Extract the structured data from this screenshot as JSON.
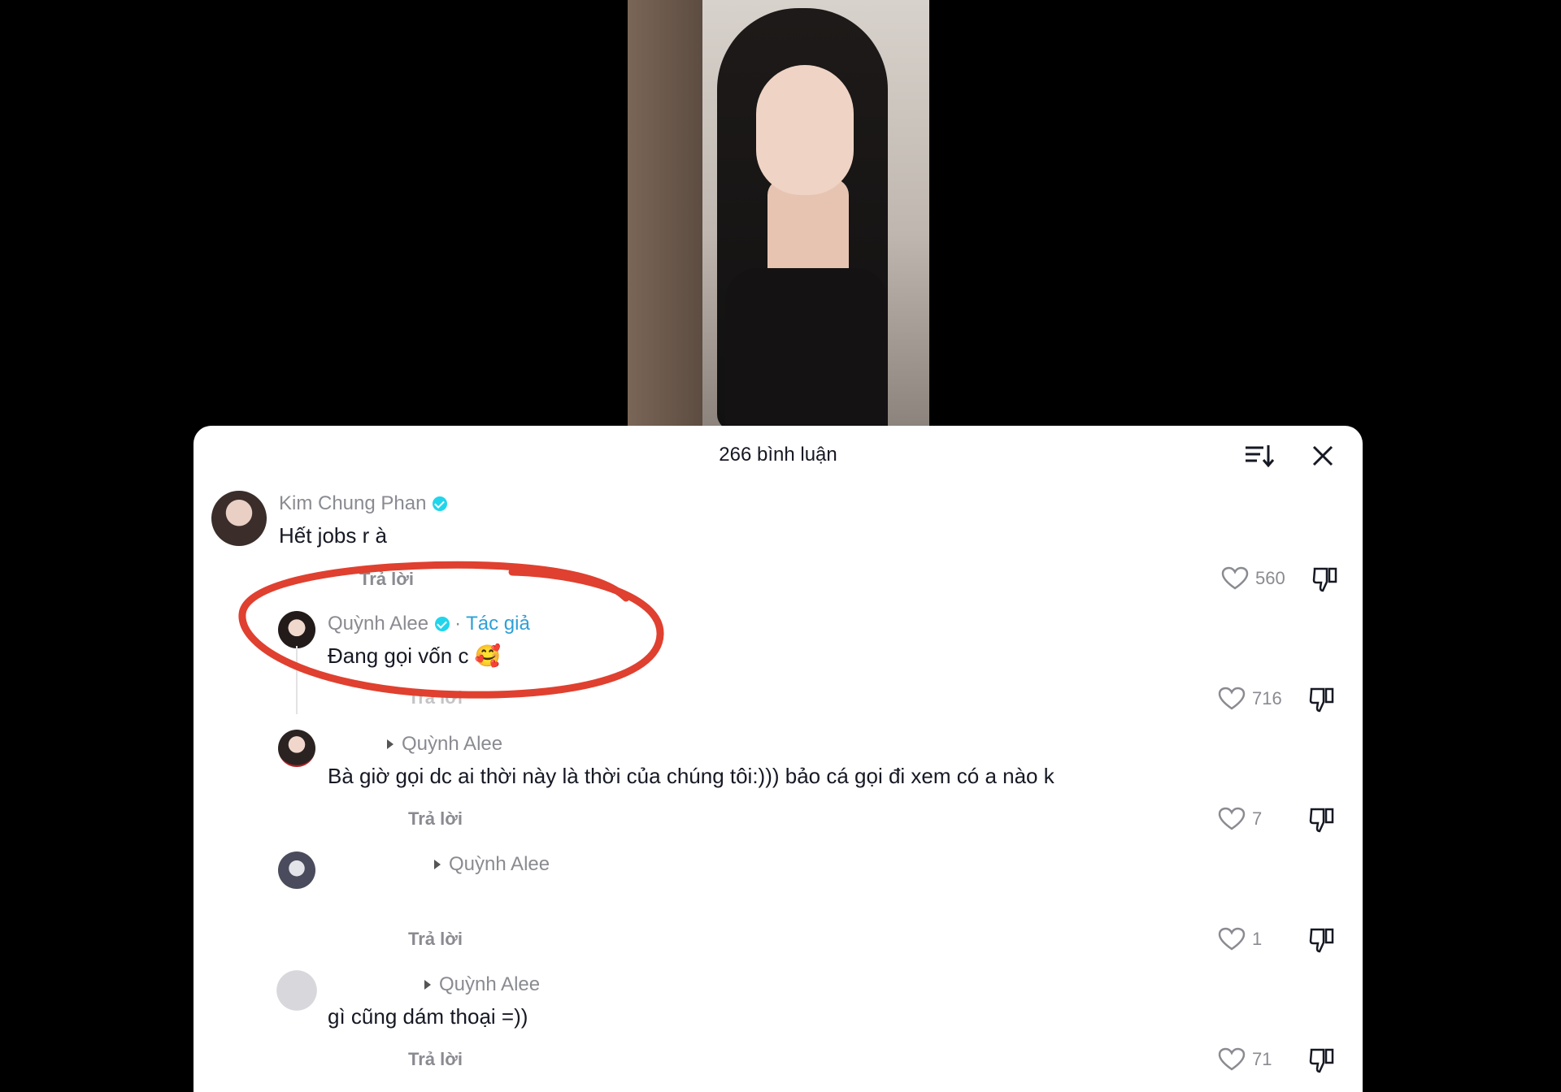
{
  "header": {
    "title": "266 bình luận"
  },
  "comments": [
    {
      "author": "Kim Chung Phan",
      "verified": true,
      "text": "Hết jobs r à",
      "reply_label": "Trả lời",
      "likes": "560"
    },
    {
      "author": "Quỳnh Alee",
      "verified": true,
      "author_tag": "Tác giả",
      "text": "Đang gọi vốn c 🥰",
      "reply_label": "Trả lời",
      "likes": "716"
    },
    {
      "reply_to": "Quỳnh Alee",
      "text": "Bà giờ gọi dc ai thời này là thời của chúng tôi:))) bảo cá gọi đi xem có a nào k",
      "reply_label": "Trả lời",
      "likes": "7"
    },
    {
      "reply_to": "Quỳnh Alee",
      "text": "",
      "reply_label": "Trả lời",
      "likes": "1"
    },
    {
      "reply_to": "Quỳnh Alee",
      "text": "gì cũng dám thoại =))",
      "reply_label": "Trả lời",
      "likes": "71"
    }
  ],
  "colors": {
    "author_tag": "#2ea0d8",
    "annotation": "#e0402f",
    "verified": "#20d5ec"
  },
  "icons": [
    "sort-icon",
    "close-icon",
    "heart-icon",
    "dislike-icon",
    "verified-icon"
  ]
}
